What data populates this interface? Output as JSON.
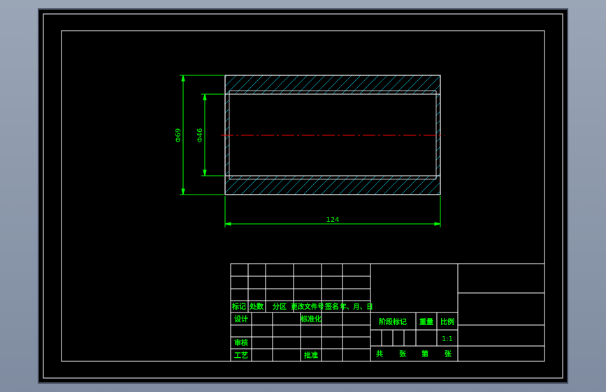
{
  "drawing": {
    "dimensions": {
      "outer_diameter_label": "Φ69",
      "inner_diameter_label": "Φ46",
      "length_label": "124"
    },
    "colors": {
      "background": "#000000",
      "frame": "#ffffff",
      "dimension": "#00ff00",
      "hatch": "#00e0ff",
      "outline": "#ffffff",
      "centerline": "#ff0000",
      "title_text": "#00ff00"
    }
  },
  "title_block": {
    "headers": {
      "mark": "标记",
      "count": "处数",
      "zone": "分区",
      "change_doc": "更改文件号",
      "signature": "签名",
      "date": "年、月、日"
    },
    "roles": {
      "design": "设计",
      "standardize": "标准化",
      "review": "审核",
      "process": "工艺",
      "approve": "批准"
    },
    "stage": {
      "stage_mark": "阶段标记",
      "weight": "重量",
      "scale": "比例",
      "scale_value": "1:1"
    },
    "sheets": {
      "total": "共",
      "sheet": "张",
      "number": "第",
      "page": "张"
    }
  }
}
